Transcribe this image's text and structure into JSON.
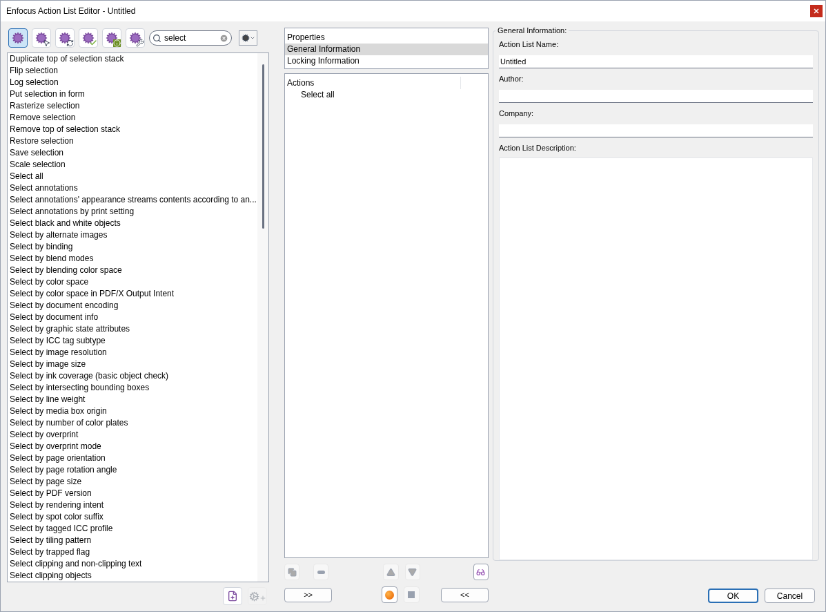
{
  "window": {
    "title": "Enfocus Action List Editor - Untitled"
  },
  "toolbar": {
    "buttons": [
      {
        "kind": "all",
        "selected": true
      },
      {
        "kind": "select",
        "selected": false
      },
      {
        "kind": "convert",
        "selected": false
      },
      {
        "kind": "check",
        "selected": false
      },
      {
        "kind": "info",
        "selected": false
      },
      {
        "kind": "tool",
        "selected": false
      }
    ],
    "search": {
      "value": "select"
    }
  },
  "action_list": [
    "Duplicate top of selection stack",
    "Flip selection",
    "Log selection",
    "Put selection in form",
    "Rasterize selection",
    "Remove selection",
    "Remove top of selection stack",
    "Restore selection",
    "Save selection",
    "Scale selection",
    "Select all",
    "Select annotations",
    "Select annotations' appearance streams contents according to an...",
    "Select annotations by print setting",
    "Select black and white objects",
    "Select by alternate images",
    "Select by binding",
    "Select by blend modes",
    "Select by blending color space",
    "Select by color space",
    "Select by color space in PDF/X Output Intent",
    "Select by document encoding",
    "Select by document info",
    "Select by graphic state attributes",
    "Select by ICC tag subtype",
    "Select by image resolution",
    "Select by image size",
    "Select by ink coverage (basic object check)",
    "Select by intersecting bounding boxes",
    "Select by line weight",
    "Select by media box origin",
    "Select by number of color plates",
    "Select by overprint",
    "Select by overprint mode",
    "Select by page orientation",
    "Select by page rotation angle",
    "Select by page size",
    "Select by PDF version",
    "Select by rendering intent",
    "Select by spot color suffix",
    "Select by tagged ICC profile",
    "Select by tiling pattern",
    "Select by trapped flag",
    "Select clipping and non-clipping text",
    "Select clipping objects"
  ],
  "list_buttons": [
    {
      "kind": "new-action",
      "disabled": false
    },
    {
      "kind": "add-action",
      "disabled": true
    }
  ],
  "properties": {
    "heading": "Properties",
    "items": [
      {
        "label": "General Information",
        "selected": true
      },
      {
        "label": "Locking Information",
        "selected": false
      }
    ]
  },
  "actions": {
    "heading": "Actions",
    "items": [
      "Select all"
    ]
  },
  "action_buttons": [
    {
      "kind": "duplicate",
      "disabled": true
    },
    {
      "kind": "remove",
      "disabled": true
    },
    {
      "kind": "up",
      "disabled": true
    },
    {
      "kind": "down",
      "disabled": true
    },
    {
      "kind": "inspect",
      "disabled": false
    }
  ],
  "add_button": ">>",
  "record_buttons": [
    {
      "kind": "record",
      "disabled": false
    },
    {
      "kind": "stop",
      "disabled": true
    }
  ],
  "collapse_button": "<<",
  "general": {
    "legend": "General Information:",
    "fields": [
      {
        "label": "Action List Name:",
        "value": "Untitled"
      },
      {
        "label": "Author:"
      },
      {
        "label": "Company:"
      }
    ],
    "description_label": "Action List Description:"
  },
  "dialog_buttons": [
    "OK",
    "Cancel"
  ]
}
